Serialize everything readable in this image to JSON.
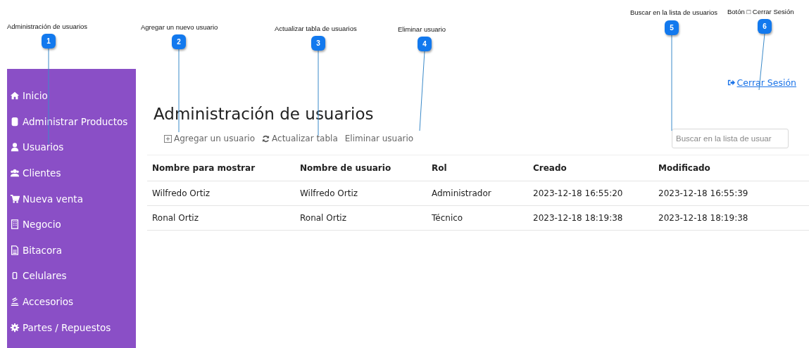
{
  "callouts": [
    {
      "number": "1",
      "label": "Administración de usuarios"
    },
    {
      "number": "2",
      "label": "Agregar un nuevo usuario"
    },
    {
      "number": "3",
      "label": "Actualizar tabla de usuarios"
    },
    {
      "number": "4",
      "label": "Eliminar usuario"
    },
    {
      "number": "5",
      "label": "Buscar en la lista de usuarios"
    },
    {
      "number": "6",
      "label": "Botón □ Cerrar Sesión"
    }
  ],
  "sidebar": {
    "items": [
      {
        "label": "Inicio"
      },
      {
        "label": "Administrar Productos"
      },
      {
        "label": "Usuarios"
      },
      {
        "label": "Clientes"
      },
      {
        "label": "Nueva venta"
      },
      {
        "label": "Negocio"
      },
      {
        "label": "Bitacora"
      },
      {
        "label": "Celulares"
      },
      {
        "label": "Accesorios"
      },
      {
        "label": "Partes / Repuestos"
      }
    ]
  },
  "logout_link": "Cerrar Sesión",
  "title": "Administración de usuarios",
  "toolbar": [
    {
      "label": "Agregar un usuario"
    },
    {
      "label": "Actualizar tabla"
    },
    {
      "label": "Eliminar usuario"
    }
  ],
  "search": {
    "placeholder": "Buscar en la lista de usuar"
  },
  "table": {
    "columns": [
      "Nombre para mostrar",
      "Nombre de usuario",
      "Rol",
      "Creado",
      "Modificado"
    ],
    "rows": [
      [
        "Wilfredo Ortiz",
        "Wilfredo Ortiz",
        "Administrador",
        "2023-12-18 16:55:20",
        "2023-12-18 16:55:39"
      ],
      [
        "Ronal Ortiz",
        "Ronal Ortiz",
        "Técnico",
        "2023-12-18 18:19:38",
        "2023-12-18 18:19:38"
      ]
    ]
  }
}
